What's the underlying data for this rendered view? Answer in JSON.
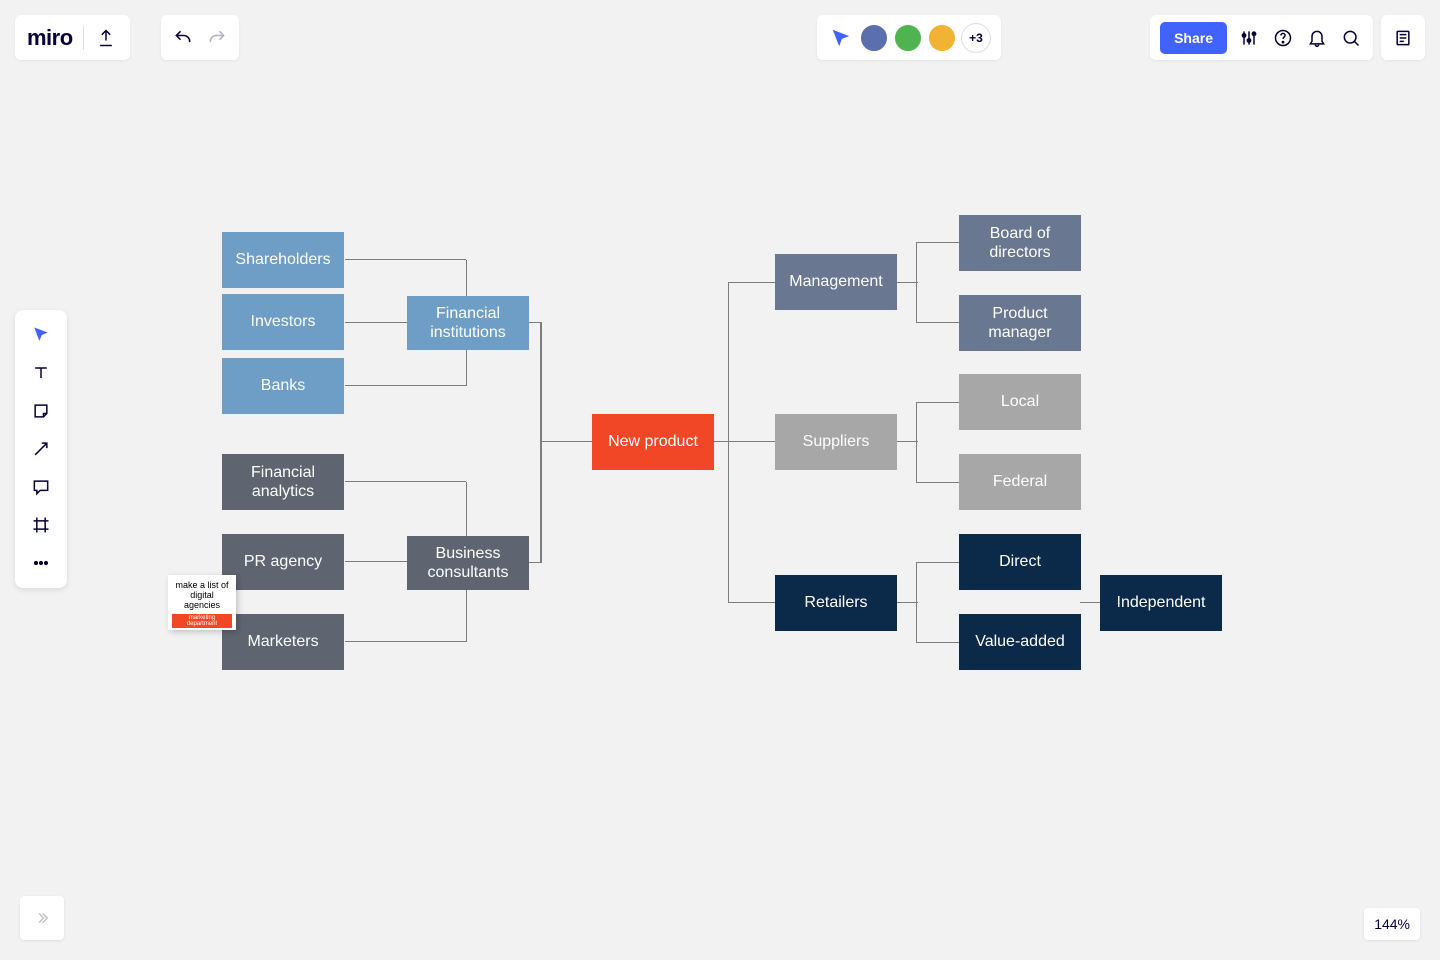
{
  "app": {
    "logo": "miro"
  },
  "collab": {
    "overflow": "+3",
    "avatars": [
      {
        "bg": "#5b6fae"
      },
      {
        "bg": "#4fb34f"
      },
      {
        "bg": "#f2b233"
      }
    ]
  },
  "share": {
    "label": "Share"
  },
  "zoom": {
    "level": "144%"
  },
  "sticky": {
    "text": "make a list of digital agencies",
    "tag": "marketing department"
  },
  "diagram": {
    "center": "New product",
    "left": {
      "fin_inst": "Financial institutions",
      "fin_children": [
        "Shareholders",
        "Investors",
        "Banks"
      ],
      "biz_cons": "Business consultants",
      "biz_children": [
        "Financial analytics",
        "PR agency",
        "Marketers"
      ]
    },
    "right": {
      "management": "Management",
      "management_children": [
        "Board of directors",
        "Product manager"
      ],
      "suppliers": "Suppliers",
      "suppliers_children": [
        "Local",
        "Federal"
      ],
      "retailers": "Retailers",
      "retailers_children": [
        "Direct",
        "Value-added"
      ],
      "retailers_leaf": "Independent"
    }
  }
}
